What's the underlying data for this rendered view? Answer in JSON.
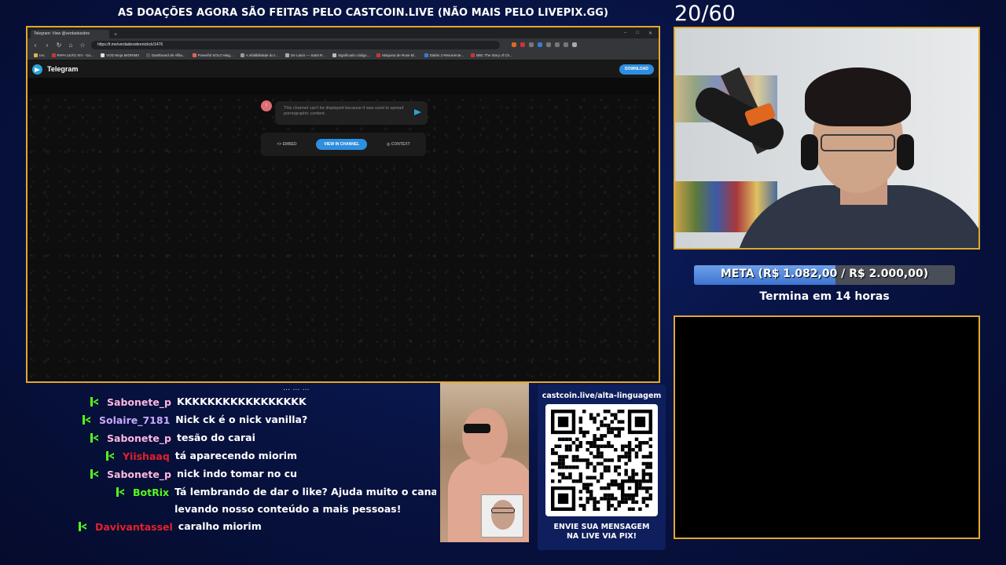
{
  "overlay": {
    "banner": "AS DOAÇÕES AGORA SÃO FEITAS PELO CASTCOIN.LIVE (NÃO MAIS PELO LIVEPIX.GG)",
    "counter": "20/60"
  },
  "browser": {
    "tab_title": "Telegram: View @verdadesobre",
    "url": "https://t.me/verdadesobrenickck/1476",
    "bookmarks": [
      "IAs",
      "PAPA LEÃO XIV - Go...",
      "VOD Ninja MIORIM3",
      "Dashboard de Afilia...",
      "Powerful SOLO Mag...",
      "A infalibilidade do I...",
      "De Laicis — Saint R...",
      "Significado código...",
      "Máquina de Rose Bl...",
      "Diablo 2 Resurrecte...",
      "BBC The Story of Ch..."
    ]
  },
  "telegram": {
    "brand": "Telegram",
    "download": "DOWNLOAD",
    "avatar_initial": "!",
    "message": "This channel can't be displayed because it was used to spread pornographic content.",
    "actions": {
      "embed": "EMBED",
      "view": "VIEW IN CHANNEL",
      "context": "CONTEXT"
    }
  },
  "goal": {
    "label": "META (R$ 1.082,00 / R$ 2.000,00)",
    "progress": 0.541,
    "ends": "Termina em 14 horas"
  },
  "chat": {
    "clipped_line": "... ... ...",
    "messages": [
      {
        "user": "Sabonete_p",
        "text": "KKKKKKKKKKKKKKKKK",
        "color": "#ffb7e0"
      },
      {
        "user": "Solaire_7181",
        "text": "Nick ck é o nick vanilla?",
        "color": "#c9a8ff"
      },
      {
        "user": "Sabonete_p",
        "text": "tesão do carai",
        "color": "#ffb7e0"
      },
      {
        "user": "Yiishaaq",
        "text": "tá aparecendo miorim",
        "color": "#e4202a"
      },
      {
        "user": "Sabonete_p",
        "text": "nick indo tomar no cu",
        "color": "#ffb7e0"
      },
      {
        "user": "BotRix",
        "text": "Tá lembrando de dar o like? Ajuda muito o canal,",
        "text2": "levando nosso conteúdo a mais pessoas!",
        "color": "#53fc18"
      },
      {
        "user": "Davivantassel",
        "text": "caralho miorim",
        "color": "#e4202a"
      }
    ]
  },
  "qr": {
    "url": "castcoin.live/alta-linguagem",
    "line1": "ENVIE SUA MENSAGEM",
    "line2": "NA LIVE VIA PIX!"
  },
  "colors": {
    "frame": "#e2a82c",
    "goal_fill": "#3d74d0",
    "badge": "#53fc18"
  }
}
